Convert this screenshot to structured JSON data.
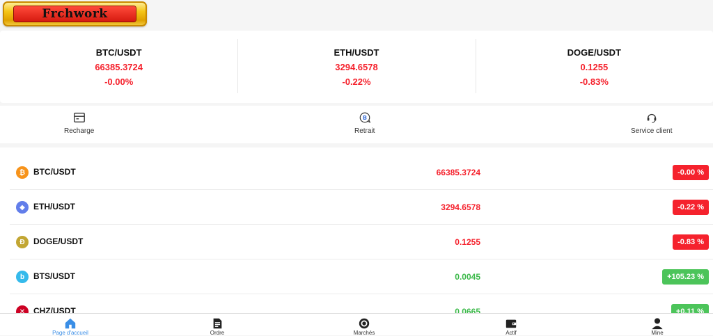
{
  "brand": {
    "logo_text": "Frchwork"
  },
  "tickers": [
    {
      "pair": "BTC/USDT",
      "price": "66385.3724",
      "change": "-0.00%"
    },
    {
      "pair": "ETH/USDT",
      "price": "3294.6578",
      "change": "-0.22%"
    },
    {
      "pair": "DOGE/USDT",
      "price": "0.1255",
      "change": "-0.83%"
    }
  ],
  "actions": [
    {
      "label": "Recharge",
      "icon": "wallet-icon"
    },
    {
      "label": "Retrait",
      "icon": "bitcoin-withdraw-icon"
    },
    {
      "label": "Service client",
      "icon": "headset-icon"
    }
  ],
  "market": [
    {
      "pair": "BTC/USDT",
      "price": "66385.3724",
      "change": "-0.00 %",
      "trend": "down",
      "icon": "bitcoin-icon",
      "icon_color": "#f7931a"
    },
    {
      "pair": "ETH/USDT",
      "price": "3294.6578",
      "change": "-0.22 %",
      "trend": "down",
      "icon": "ethereum-icon",
      "icon_color": "#627eea"
    },
    {
      "pair": "DOGE/USDT",
      "price": "0.1255",
      "change": "-0.83 %",
      "trend": "down",
      "icon": "dogecoin-icon",
      "icon_color": "#c2a633"
    },
    {
      "pair": "BTS/USDT",
      "price": "0.0045",
      "change": "+105.23 %",
      "trend": "up",
      "icon": "bitshares-icon",
      "icon_color": "#35baeb"
    },
    {
      "pair": "CHZ/USDT",
      "price": "0.0665",
      "change": "+0.11 %",
      "trend": "up",
      "icon": "chiliz-icon",
      "icon_color": "#cd0124"
    }
  ],
  "bottom_nav": [
    {
      "label": "Page d'accueil",
      "icon": "home-icon",
      "active": true
    },
    {
      "label": "Ordre",
      "icon": "document-icon",
      "active": false
    },
    {
      "label": "Marchés",
      "icon": "market-icon",
      "active": false
    },
    {
      "label": "Actif",
      "icon": "wallet-icon",
      "active": false
    },
    {
      "label": "Mine",
      "icon": "user-icon",
      "active": false
    }
  ],
  "colors": {
    "up": "#4cc45a",
    "down": "#f5222d",
    "active_nav": "#3a8ee6"
  }
}
